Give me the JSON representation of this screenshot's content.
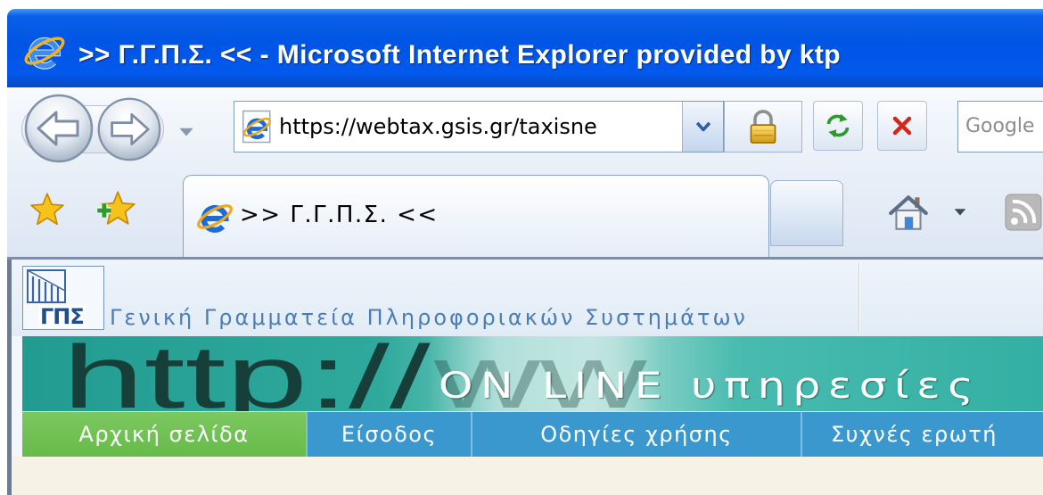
{
  "window": {
    "title": ">> Γ.Γ.Π.Σ. << - Microsoft Internet Explorer provided by ktp"
  },
  "toolbar": {
    "url": "https://webtax.gsis.gr/taxisne",
    "search_placeholder": "Google"
  },
  "tabs": [
    {
      "label": ">> Γ.Γ.Π.Σ. <<",
      "active": true
    }
  ],
  "site": {
    "logo_text": "ΓΠΣ",
    "org_name": "Γενική Γραμματεία Πληροφοριακών Συστημάτων",
    "banner": {
      "url_text": "http://",
      "url_text_faint": "ww",
      "title": "ON LINE υπηρεσίες"
    },
    "nav": [
      {
        "label": "Αρχική σελίδα",
        "active": true
      },
      {
        "label": "Είσοδος",
        "active": false
      },
      {
        "label": "Οδηγίες χρήσης",
        "active": false
      },
      {
        "label": "Συχνές ερωτή",
        "active": false
      }
    ]
  },
  "icons": [
    "ie-logo-icon",
    "back-arrow-icon",
    "forward-arrow-icon",
    "dropdown-arrow-icon",
    "page-icon",
    "chevron-down-icon",
    "lock-icon",
    "refresh-icon",
    "stop-icon",
    "favorites-star-icon",
    "add-favorites-icon",
    "home-icon",
    "rss-feed-icon"
  ],
  "colors": {
    "title_bar": "#0055E5",
    "nav_bar": "#3A98CF",
    "nav_active": "#66BB4A",
    "banner": "#2EA99C",
    "org_text": "#4B7EB6",
    "content_bg": "#F6F2E6"
  }
}
